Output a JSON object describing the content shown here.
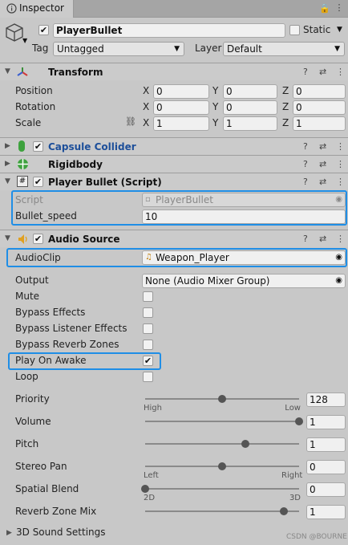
{
  "tab": {
    "title": "Inspector"
  },
  "object": {
    "name": "PlayerBullet",
    "static_label": "Static",
    "tag_label": "Tag",
    "tag_value": "Untagged",
    "layer_label": "Layer",
    "layer_value": "Default"
  },
  "transform": {
    "title": "Transform",
    "rows": [
      {
        "label": "Position",
        "x": "0",
        "y": "0",
        "z": "0"
      },
      {
        "label": "Rotation",
        "x": "0",
        "y": "0",
        "z": "0"
      },
      {
        "label": "Scale",
        "x": "1",
        "y": "1",
        "z": "1"
      }
    ],
    "axis_x": "X",
    "axis_y": "Y",
    "axis_z": "Z"
  },
  "capsule": {
    "title": "Capsule Collider"
  },
  "rigidbody": {
    "title": "Rigidbody"
  },
  "script": {
    "title": "Player Bullet (Script)",
    "script_label": "Script",
    "script_value": "PlayerBullet",
    "speed_label": "Bullet_speed",
    "speed_value": "10"
  },
  "audio": {
    "title": "Audio Source",
    "clip_label": "AudioClip",
    "clip_value": "Weapon_Player",
    "output_label": "Output",
    "output_value": "None (Audio Mixer Group)",
    "mute_label": "Mute",
    "bypass_effects_label": "Bypass Effects",
    "bypass_listener_label": "Bypass Listener Effects",
    "bypass_reverb_label": "Bypass Reverb Zones",
    "play_on_awake_label": "Play On Awake",
    "loop_label": "Loop",
    "priority_label": "Priority",
    "priority_value": "128",
    "priority_high": "High",
    "priority_low": "Low",
    "priority_fraction": 0.5,
    "volume_label": "Volume",
    "volume_value": "1",
    "volume_fraction": 1.0,
    "pitch_label": "Pitch",
    "pitch_value": "1",
    "pitch_fraction": 0.65,
    "stereo_label": "Stereo Pan",
    "stereo_value": "0",
    "stereo_left": "Left",
    "stereo_right": "Right",
    "stereo_fraction": 0.5,
    "spatial_label": "Spatial Blend",
    "spatial_value": "0",
    "spatial_2d": "2D",
    "spatial_3d": "3D",
    "spatial_fraction": 0.0,
    "reverb_label": "Reverb Zone Mix",
    "reverb_value": "1",
    "reverb_fraction": 0.9,
    "sound3d_label": "3D Sound Settings"
  },
  "watermark": "CSDN @BOURNE"
}
